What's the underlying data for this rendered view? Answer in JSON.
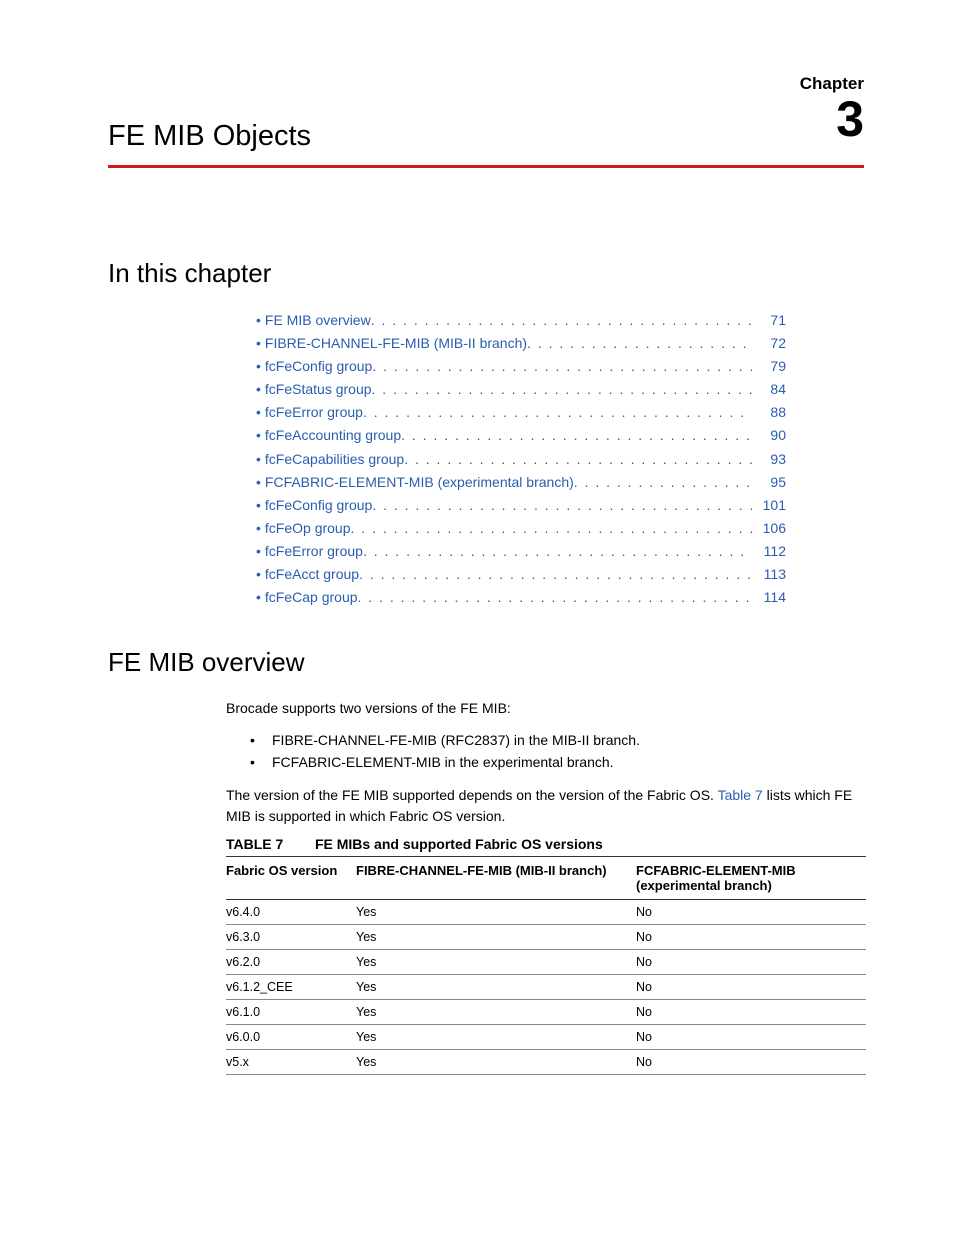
{
  "chapter": {
    "label": "Chapter",
    "number": "3",
    "title": "FE MIB Objects"
  },
  "sections": {
    "toc_heading": "In this chapter",
    "overview_heading": "FE MIB overview"
  },
  "toc": [
    {
      "label": "FE MIB overview",
      "page": "71"
    },
    {
      "label": "FIBRE-CHANNEL-FE-MIB (MIB-II branch)",
      "page": "72"
    },
    {
      "label": "fcFeConfig group",
      "page": "79"
    },
    {
      "label": "fcFeStatus group",
      "page": "84"
    },
    {
      "label": "fcFeError group",
      "page": "88"
    },
    {
      "label": "fcFeAccounting group",
      "page": "90"
    },
    {
      "label": "fcFeCapabilities group",
      "page": "93"
    },
    {
      "label": "FCFABRIC-ELEMENT-MIB (experimental branch)",
      "page": "95"
    },
    {
      "label": "fcFeConfig group",
      "page": "101"
    },
    {
      "label": "fcFeOp group",
      "page": "106"
    },
    {
      "label": "fcFeError group",
      "page": "112"
    },
    {
      "label": "fcFeAcct group",
      "page": "113"
    },
    {
      "label": "fcFeCap group",
      "page": "114"
    }
  ],
  "overview": {
    "intro": "Brocade supports two versions of the FE MIB:",
    "bullets": [
      "FIBRE-CHANNEL-FE-MIB (RFC2837) in the MIB-II branch.",
      "FCFABRIC-ELEMENT-MIB in the experimental branch."
    ],
    "para2_pre": "The version of the FE MIB supported depends on the version of the Fabric OS. ",
    "para2_link": "Table 7",
    "para2_post": " lists which FE MIB is supported in which Fabric OS version."
  },
  "table": {
    "number": "TABLE 7",
    "title": "FE MIBs and supported Fabric OS versions",
    "headers": [
      "Fabric OS version",
      "FIBRE-CHANNEL-FE-MIB (MIB-II branch)",
      "FCFABRIC-ELEMENT-MIB (experimental branch)"
    ],
    "rows": [
      [
        "v6.4.0",
        "Yes",
        "No"
      ],
      [
        "v6.3.0",
        "Yes",
        "No"
      ],
      [
        "v6.2.0",
        "Yes",
        "No"
      ],
      [
        "v6.1.2_CEE",
        "Yes",
        "No"
      ],
      [
        "v6.1.0",
        "Yes",
        "No"
      ],
      [
        "v6.0.0",
        "Yes",
        "No"
      ],
      [
        "v5.x",
        "Yes",
        "No"
      ]
    ]
  }
}
